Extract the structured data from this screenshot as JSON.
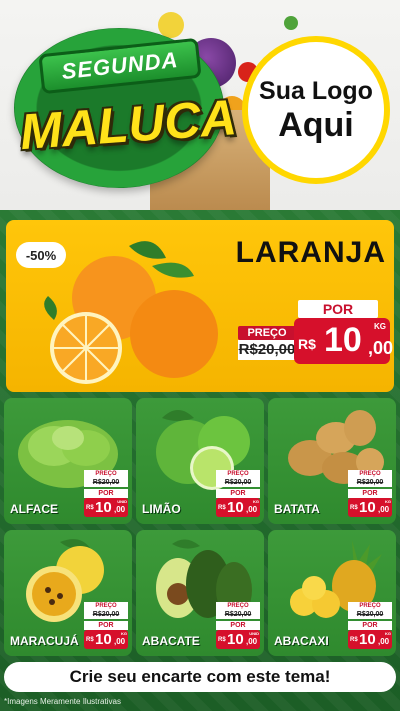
{
  "header": {
    "badge_top": "SEGUNDA",
    "badge_main": "MALUCA",
    "logo_line1": "Sua Logo",
    "logo_line2": "Aqui"
  },
  "featured": {
    "discount": "-50%",
    "name": "LARANJA",
    "old_label": "PREÇO",
    "old_price": "R$20,00",
    "por_label": "POR",
    "currency": "R$",
    "price_int": "10",
    "price_cents": ",00",
    "unit": "KG"
  },
  "products": [
    {
      "name": "ALFACE",
      "old_label": "PREÇO",
      "old_price": "R$20,00",
      "por": "POR",
      "currency": "R$",
      "price_int": "10",
      "price_cents": ",00",
      "unit": "UNID"
    },
    {
      "name": "LIMÃO",
      "old_label": "PREÇO",
      "old_price": "R$20,00",
      "por": "POR",
      "currency": "R$",
      "price_int": "10",
      "price_cents": ",00",
      "unit": "KG"
    },
    {
      "name": "BATATA",
      "old_label": "PREÇO",
      "old_price": "R$20,00",
      "por": "POR",
      "currency": "R$",
      "price_int": "10",
      "price_cents": ",00",
      "unit": "KG"
    },
    {
      "name": "MARACUJÁ",
      "old_label": "PREÇO",
      "old_price": "R$20,00",
      "por": "POR",
      "currency": "R$",
      "price_int": "10",
      "price_cents": ",00",
      "unit": "KG"
    },
    {
      "name": "ABACATE",
      "old_label": "PREÇO",
      "old_price": "R$20,00",
      "por": "POR",
      "currency": "R$",
      "price_int": "10",
      "price_cents": ",00",
      "unit": "UNID"
    },
    {
      "name": "ABACAXI",
      "old_label": "PREÇO",
      "old_price": "R$20,00",
      "por": "POR",
      "currency": "R$",
      "price_int": "10",
      "price_cents": ",00",
      "unit": "KG"
    }
  ],
  "footer": {
    "cta": "Crie seu encarte com este tema!",
    "disclaimer": "*Imagens Meramente Ilustrativas"
  },
  "colors": {
    "board_green": "#1e6b2c",
    "feature_yellow": "#ffc60a",
    "price_red": "#d6102b",
    "badge_yellow": "#ffe21a"
  }
}
